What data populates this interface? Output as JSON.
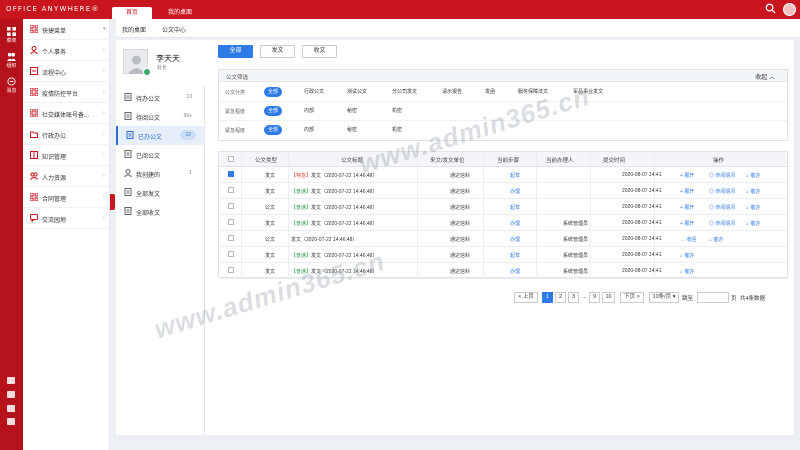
{
  "app": {
    "brand": "OFFICE ANYWHERE®"
  },
  "top_tabs": [
    {
      "label": "首页"
    },
    {
      "label": "我的桌面"
    }
  ],
  "rail": {
    "items": [
      {
        "label": "菜单"
      },
      {
        "label": "组织"
      },
      {
        "label": "消息"
      }
    ],
    "badge": "new"
  },
  "menu": {
    "items": [
      {
        "label": "快捷菜单",
        "icon": "grid-icon",
        "chevron": "chevron-down-icon"
      },
      {
        "label": "个人事务",
        "icon": "person-icon",
        "chevron": "chevron-right-icon"
      },
      {
        "label": "流程中心",
        "icon": "flow-icon",
        "chevron": "chevron-right-icon"
      },
      {
        "label": "疫情防控平台",
        "icon": "grid-icon",
        "chevron": "chevron-right-icon"
      },
      {
        "label": "社交媒体账号备...",
        "icon": "grid-icon",
        "chevron": "chevron-right-icon"
      },
      {
        "label": "行政办公",
        "icon": "folder-icon",
        "chevron": "chevron-right-icon"
      },
      {
        "label": "知识管理",
        "icon": "book-icon",
        "chevron": "chevron-right-icon"
      },
      {
        "label": "人力资源",
        "icon": "people-icon",
        "chevron": "chevron-right-icon"
      },
      {
        "label": "合同管理",
        "icon": "grid-icon",
        "chevron": "chevron-right-icon"
      },
      {
        "label": "交流园地",
        "icon": "chat-icon",
        "chevron": "chevron-right-icon"
      }
    ]
  },
  "sub_tabs": [
    {
      "label": "我的桌面"
    },
    {
      "label": "公文中心"
    }
  ],
  "user": {
    "name": "李天天",
    "title": "处长"
  },
  "left_nav": {
    "items": [
      {
        "label": "待办公文",
        "count": "13",
        "icon": "doc-icon"
      },
      {
        "label": "待阅公文",
        "count": "99+",
        "icon": "doc-icon"
      },
      {
        "label": "已办公文",
        "count": "12",
        "icon": "doc-icon"
      },
      {
        "label": "已阅公文",
        "count": "",
        "icon": "doc-icon"
      },
      {
        "label": "我创建的",
        "count": "1",
        "icon": "user-icon"
      },
      {
        "label": "全部发文",
        "count": "",
        "icon": "doc-icon"
      },
      {
        "label": "全部收文",
        "count": "",
        "icon": "doc-icon"
      }
    ]
  },
  "type_buttons": [
    {
      "label": "全部"
    },
    {
      "label": "发文"
    },
    {
      "label": "收文"
    }
  ],
  "filters": {
    "title": "公文筛选",
    "collapse_label": "收起",
    "rows": [
      {
        "label": "公文分类",
        "options": [
          "全部",
          "行政公文",
          "测试公文",
          "分公司发文",
          "请示报告",
          "发函",
          "服务保障法文",
          "军品事业发文"
        ]
      },
      {
        "label": "紧急程度",
        "options": [
          "全部",
          "内部",
          "秘密",
          "机密"
        ]
      },
      {
        "label": "紧急程度",
        "options": [
          "全部",
          "内部",
          "秘密",
          "机密"
        ]
      }
    ]
  },
  "table": {
    "headers": [
      "",
      "公文类型",
      "公文标题",
      "来文/发文单位",
      "当前步骤",
      "当前办理人",
      "提交时间",
      "操作"
    ],
    "rows": [
      {
        "checked": true,
        "type": "发文",
        "tag": "【特急】",
        "tag_kind": "urgent",
        "title": "发文（2020-07-22 14:46:48）",
        "unit": "通达信科",
        "step": "起草",
        "handler": "",
        "time": "2020-08-07  14:41",
        "actions": [
          "+ 展开",
          "◎ 传阅情况",
          "⌂ 催办"
        ]
      },
      {
        "checked": false,
        "type": "发文",
        "tag": "【普通】",
        "tag_kind": "normal",
        "title": "发文（2020-07-22 14:46:48）",
        "unit": "通达信科",
        "step": "办理",
        "handler": "",
        "time": "2020-08-07  14:41",
        "actions": [
          "+ 展开",
          "◎ 传阅情况",
          "⌂ 催办"
        ]
      },
      {
        "checked": false,
        "type": "公文",
        "tag": "【普通】",
        "tag_kind": "normal",
        "title": "发文（2020-07-22 14:46:48）",
        "unit": "通达信科",
        "step": "起草",
        "handler": "",
        "time": "2020-08-07  14:41",
        "actions": [
          "+ 展开",
          "◎ 传阅情况",
          "⌂ 催办"
        ]
      },
      {
        "checked": false,
        "type": "发文",
        "tag": "【普通】",
        "tag_kind": "normal",
        "title": "发文（2020-07-22 14:46:48）",
        "unit": "通达信科",
        "step": "办理",
        "handler": "系统管理员",
        "time": "2020-08-07  14:41",
        "actions": [
          "+ 展开",
          "◎ 传阅情况",
          "⌂ 催办"
        ]
      },
      {
        "checked": false,
        "type": "公文",
        "tag": "",
        "tag_kind": "",
        "title": "发文（2020-07-22 14:46:48）",
        "unit": "通达信科",
        "step": "办理",
        "handler": "系统管理员",
        "time": "2020-08-07  14:41",
        "actions": [
          "← 收回",
          "⌂ 催办",
          ""
        ]
      },
      {
        "checked": false,
        "type": "发文",
        "tag": "【普通】",
        "tag_kind": "normal",
        "title": "发文（2020-07-22 14:46:48）",
        "unit": "通达信科",
        "step": "起草",
        "handler": "系统管理员",
        "time": "2020-08-07  14:41",
        "actions": [
          "⌂ 催办",
          "",
          ""
        ]
      },
      {
        "checked": false,
        "type": "发文",
        "tag": "【普通】",
        "tag_kind": "normal",
        "title": "发文（2020-07-22 14:46:48）",
        "unit": "通达信科",
        "step": "办理",
        "handler": "系统管理员",
        "time": "2020-08-07  14:41",
        "actions": [
          "⌂ 催办",
          "",
          ""
        ]
      }
    ]
  },
  "pagination": {
    "prev": "< 上页",
    "pages": [
      "1",
      "2",
      "3"
    ],
    "ellipsis": "...",
    "pages_end": [
      "9",
      "10"
    ],
    "next": "下页 >",
    "page_size": "10条/页",
    "jump_label": "跳至",
    "jump_value": "",
    "page_unit": "页",
    "total": "共4条数据"
  },
  "watermark": "www.admin365.cn",
  "colors": {
    "brand_red": "#c9151e",
    "primary_blue": "#2e7be8",
    "urgent": "#e0403a",
    "normal": "#2c9c4f"
  }
}
